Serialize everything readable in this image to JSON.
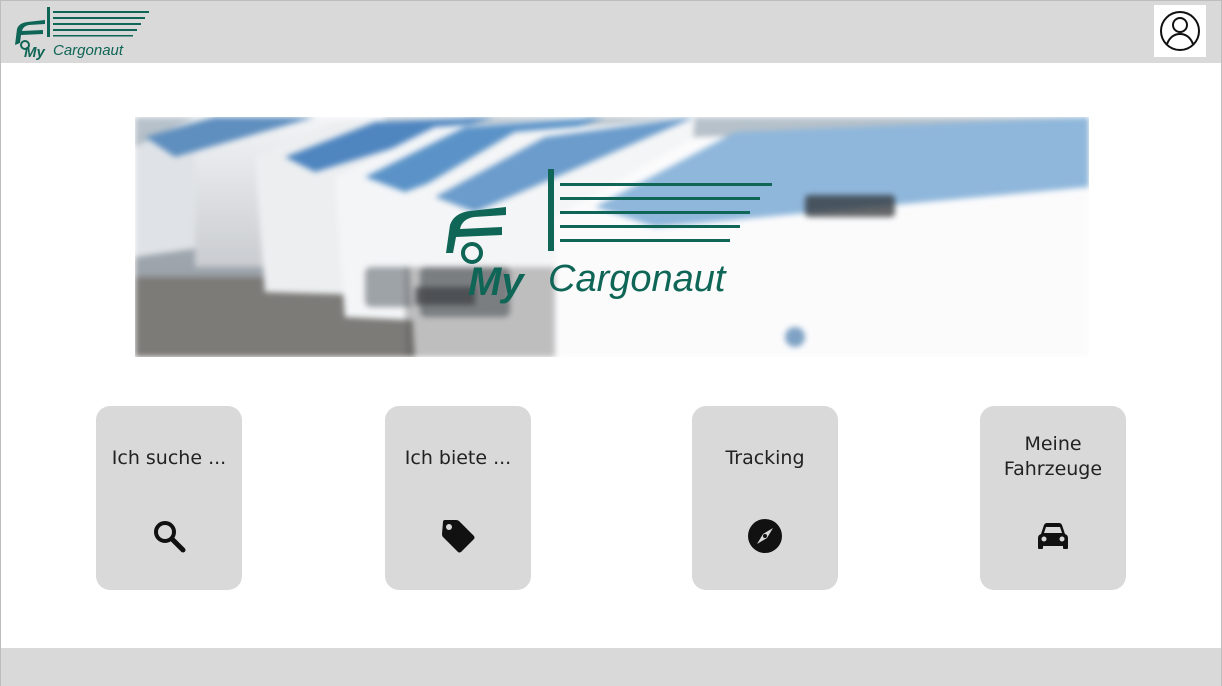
{
  "brand": {
    "name_my": "My",
    "name_cargonaut": "Cargonaut",
    "color": "#0f6556"
  },
  "header": {
    "profile_icon": "user-circle-icon"
  },
  "hero": {
    "image": "white-vans-fleet-photo"
  },
  "tiles": [
    {
      "label": "Ich suche ...",
      "icon": "search-icon"
    },
    {
      "label": "Ich biete ...",
      "icon": "tag-icon"
    },
    {
      "label": "Tracking",
      "icon": "compass-icon"
    },
    {
      "label_line1": "Meine",
      "label_line2": "Fahrzeuge",
      "icon": "car-icon"
    }
  ]
}
